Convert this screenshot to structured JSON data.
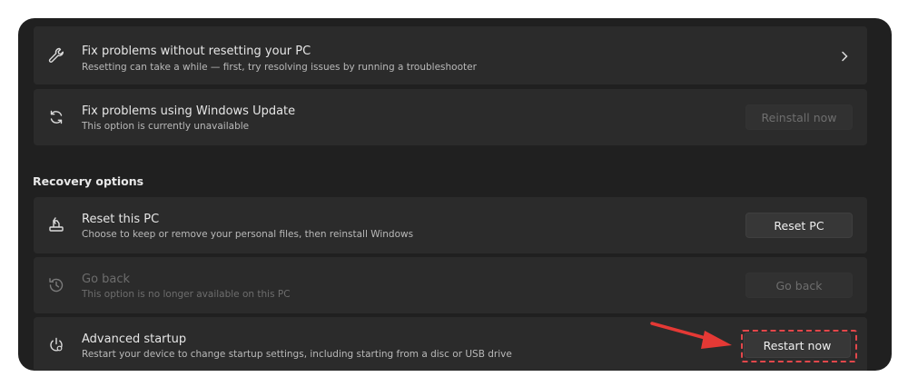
{
  "cards": [
    {
      "title": "Fix problems without resetting your PC",
      "subtitle": "Resetting can take a while — first, try resolving issues by running a troubleshooter",
      "icon": "wrench-icon"
    },
    {
      "title": "Fix problems using Windows Update",
      "subtitle": "This option is currently unavailable",
      "button": "Reinstall now",
      "icon": "refresh-icon"
    }
  ],
  "recovery": {
    "section_title": "Recovery options",
    "items": [
      {
        "title": "Reset this PC",
        "subtitle": "Choose to keep or remove your personal files, then reinstall Windows",
        "button": "Reset PC",
        "icon": "reset-pc-icon"
      },
      {
        "title": "Go back",
        "subtitle": "This option is no longer available on this PC",
        "button": "Go back",
        "icon": "history-icon"
      },
      {
        "title": "Advanced startup",
        "subtitle": "Restart your device to change startup settings, including starting from a disc or USB drive",
        "button": "Restart now",
        "icon": "power-settings-icon"
      }
    ]
  },
  "colors": {
    "highlight": "#e2474b",
    "arrow": "#e53935",
    "panel_bg": "#202020",
    "card_bg": "#2b2b2b"
  }
}
